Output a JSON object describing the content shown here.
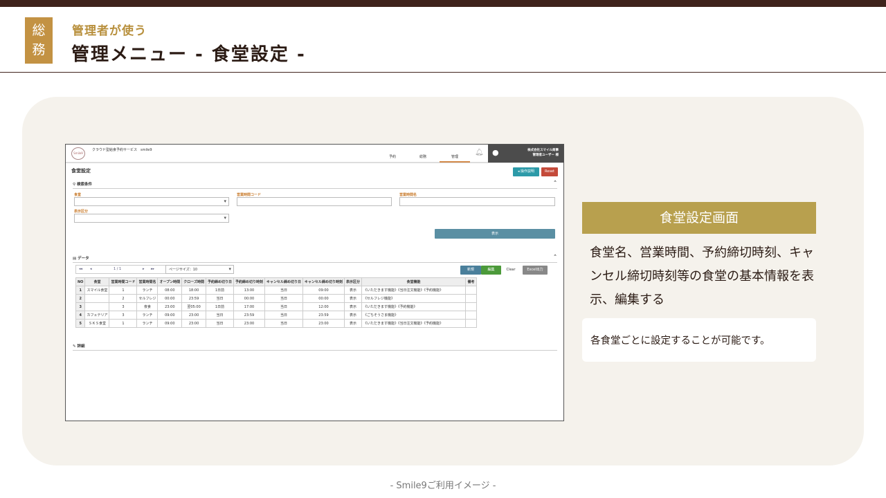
{
  "header": {
    "badge": "総\n務",
    "subtitle": "管理者が使う",
    "title": "管理メニュー - 食堂設定 -"
  },
  "screenshot": {
    "logo_text": "Smile9",
    "service_name": "クラウド型給食予約サービス　smile9",
    "nav": [
      "予約",
      "総務",
      "管理"
    ],
    "active_nav": "管理",
    "company": "株式会社スマイル商事",
    "user": "管理者ユーザー 様",
    "page_title": "食堂設定",
    "help_button": "◂ 操作説明",
    "reset_button": "Reset",
    "search_section": "検索条件",
    "fields": {
      "cafeteria_label": "食堂",
      "hours_code_label": "営業時間コード",
      "hours_name_label": "営業時間名",
      "display_label": "表示区分"
    },
    "show_button": "表示",
    "data_section": "データ",
    "pager": {
      "first": "◂◂",
      "prev": "◂",
      "page": "1 / 1",
      "next": "▸",
      "last": "▸▸"
    },
    "page_size": "ページサイズ：10",
    "buttons": {
      "new": "新規",
      "edit": "編集",
      "clear": "Clear",
      "excel": "Excel出力"
    },
    "columns": [
      "NO",
      "食堂",
      "営業時間コード",
      "営業時間名",
      "オープン時間",
      "クローズ時間",
      "予約締め切り日",
      "予約締め切り時刻",
      "キャンセル締め切り日",
      "キャンセル締め切り時刻",
      "表示区分",
      "食堂機能",
      "備考"
    ],
    "rows": [
      [
        "1",
        "スマイル食堂",
        "1",
        "ランチ",
        "08:00",
        "18:00",
        "1日前",
        "13:00",
        "当日",
        "09:00",
        "表示",
        "《いただきます機能》《当日注文機能》《予約機能》",
        ""
      ],
      [
        "2",
        "",
        "2",
        "セルフレジ",
        "00:00",
        "23:59",
        "当日",
        "00:00",
        "当日",
        "00:00",
        "表示",
        "《セルフレジ機能》",
        ""
      ],
      [
        "3",
        "",
        "3",
        "夜食",
        "23:00",
        "翌05:00",
        "1日前",
        "17:00",
        "当日",
        "12:00",
        "表示",
        "《いただきます機能》《予約機能》",
        ""
      ],
      [
        "4",
        "カフェテリア",
        "3",
        "ランチ",
        "09:00",
        "23:00",
        "当日",
        "23:59",
        "当日",
        "23:59",
        "表示",
        "《ごちそうさま機能》",
        ""
      ],
      [
        "5",
        "ＳＫＳ食堂",
        "1",
        "ランチ",
        "09:00",
        "23:00",
        "当日",
        "23:00",
        "当日",
        "23:00",
        "表示",
        "《いただきます機能》《当日注文機能》《予約機能》",
        ""
      ]
    ],
    "detail_section": "詳細"
  },
  "caption": "食堂設定画面",
  "description": "食堂名、営業時間、予約締切時刻、キャンセル締切時刻等の食堂の基本情報を表示、編集する",
  "note": "各食堂ごとに設定することが可能です。",
  "footer": "- Smile9ご利用イメージ -",
  "colors": {
    "brown": "#3f231c",
    "gold": "#c39243",
    "olive_gold": "#b8a04e",
    "panel": "#f5f2ec"
  }
}
